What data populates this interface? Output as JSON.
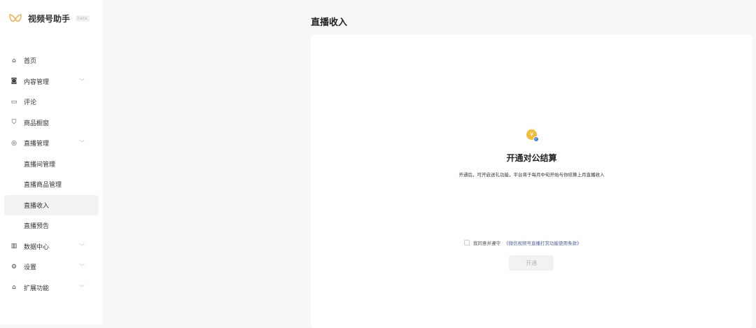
{
  "app": {
    "name": "视频号助手",
    "badge": "beta"
  },
  "sidebar": {
    "items": [
      {
        "label": "首页",
        "icon": "home-icon"
      },
      {
        "label": "内容管理",
        "icon": "camera-icon",
        "expandable": true
      },
      {
        "label": "评论",
        "icon": "comment-icon"
      },
      {
        "label": "商品橱窗",
        "icon": "bag-icon"
      },
      {
        "label": "直播管理",
        "icon": "live-icon",
        "expandable": true
      },
      {
        "label": "直播间管理",
        "sub": true
      },
      {
        "label": "直播商品管理",
        "sub": true
      },
      {
        "label": "直播收入",
        "sub": true,
        "active": true
      },
      {
        "label": "直播预告",
        "sub": true
      },
      {
        "label": "数据中心",
        "icon": "chart-icon",
        "expandable": true
      },
      {
        "label": "设置",
        "icon": "gear-icon",
        "expandable": true
      },
      {
        "label": "扩展功能",
        "icon": "puzzle-icon",
        "expandable": true
      }
    ]
  },
  "main": {
    "title": "直播收入",
    "heading": "开通对公结算",
    "description": "开通后，可开启送礼功能，平台将于每月中旬开始与你结算上月直播收入",
    "agree_text": "我同意并遵守",
    "agree_link": "《微信视频号直播打赏功能使用条款》",
    "coin_symbol": "¥",
    "button": "开通"
  },
  "colors": {
    "accent": "#f3bd3c",
    "link": "#4a5f94",
    "badge": "#3b82e0"
  }
}
